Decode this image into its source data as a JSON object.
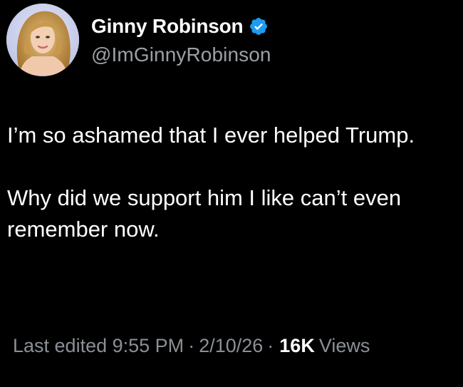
{
  "author": {
    "display_name": "Ginny Robinson",
    "handle": "@ImGinnyRobinson",
    "verified": true,
    "verified_color": "#1d9bf0",
    "avatar_icon": "profile-photo"
  },
  "tweet": {
    "paragraph_1": "I’m so ashamed that I ever helped Trump.",
    "paragraph_2": "Why did we support him I like can’t even remember now."
  },
  "meta": {
    "edited_label": "Last edited",
    "time": "9:55 PM",
    "separator": "·",
    "date": "2/10/26",
    "views_count": "16K",
    "views_label": "Views"
  },
  "colors": {
    "background": "#000000",
    "primary_text": "#ffffff",
    "secondary_text": "#8b9096"
  }
}
